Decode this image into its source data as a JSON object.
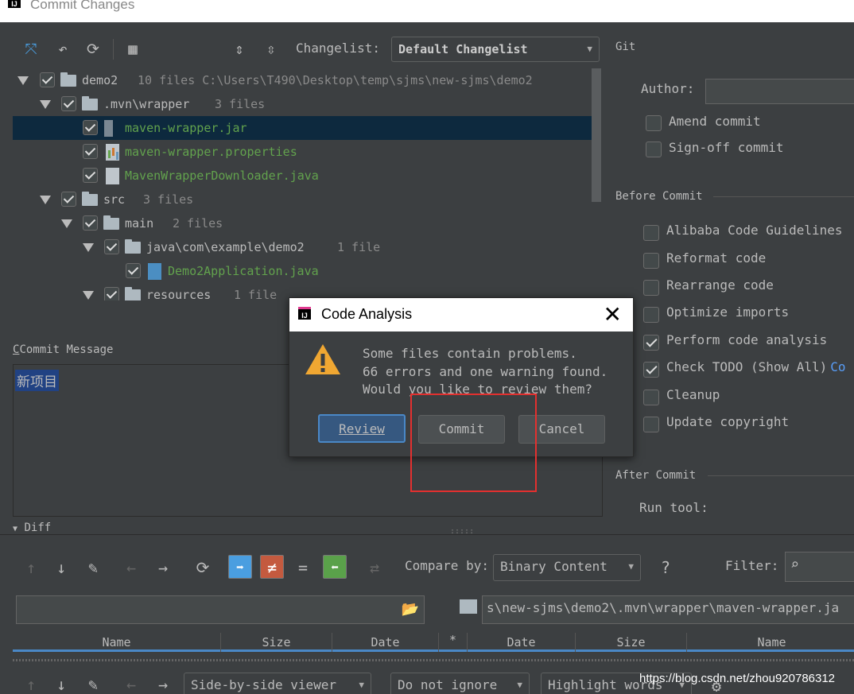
{
  "window": {
    "title": "Commit Changes"
  },
  "toolbar": {
    "changelist_label": "Changelist:",
    "changelist_value": "Default Changelist"
  },
  "tree": [
    {
      "name": "demo2",
      "meta": "10 files  C:\\Users\\T490\\Desktop\\temp\\sjms\\new-sjms\\demo2"
    },
    {
      "name": ".mvn\\wrapper",
      "meta": "3 files"
    },
    {
      "name": "maven-wrapper.jar",
      "meta": ""
    },
    {
      "name": "maven-wrapper.properties",
      "meta": ""
    },
    {
      "name": "MavenWrapperDownloader.java",
      "meta": ""
    },
    {
      "name": "src",
      "meta": "3 files"
    },
    {
      "name": "main",
      "meta": "2 files"
    },
    {
      "name": "java\\com\\example\\demo2",
      "meta": "1 file"
    },
    {
      "name": "Demo2Application.java",
      "meta": ""
    },
    {
      "name": "resources",
      "meta": "1 file"
    }
  ],
  "commit_message": {
    "label": "Commit Message",
    "text": "新项目"
  },
  "git": {
    "title": "Git",
    "author_label": "Author:",
    "amend": "Amend commit",
    "signoff": "Sign-off commit"
  },
  "before_commit": {
    "title": "Before Commit",
    "options": [
      {
        "label": "Alibaba Code Guidelines",
        "checked": false
      },
      {
        "label": "Reformat code",
        "checked": false
      },
      {
        "label": "Rearrange code",
        "checked": false
      },
      {
        "label": "Optimize imports",
        "checked": false
      },
      {
        "label": "Perform code analysis",
        "checked": true
      },
      {
        "label": "Check TODO (Show All)",
        "checked": true,
        "link": "Co"
      },
      {
        "label": "Cleanup",
        "checked": false
      },
      {
        "label": "Update copyright",
        "checked": false
      }
    ]
  },
  "after_commit": {
    "title": "After Commit",
    "run_tool": "Run tool:"
  },
  "dialog": {
    "title": "Code Analysis",
    "line1": "Some files contain problems.",
    "line2": "66 errors and one warning found.",
    "line3": "Would you like to review them?",
    "review": "Review",
    "commit": "Commit",
    "cancel": "Cancel"
  },
  "diff": {
    "label": "Diff",
    "compare_by_label": "Compare by:",
    "compare_by_value": "Binary Content",
    "filter_label": "Filter:",
    "path": "s\\new-sjms\\demo2\\.mvn\\wrapper\\maven-wrapper.ja",
    "columns_left": [
      "Name",
      "Size",
      "Date"
    ],
    "star": "*",
    "columns_right": [
      "Date",
      "Size",
      "Name"
    ],
    "viewer": "Side-by-side viewer",
    "ignore": "Do not ignore",
    "highlight": "Highlight words"
  },
  "watermark": "https://blog.csdn.net/zhou920786312"
}
